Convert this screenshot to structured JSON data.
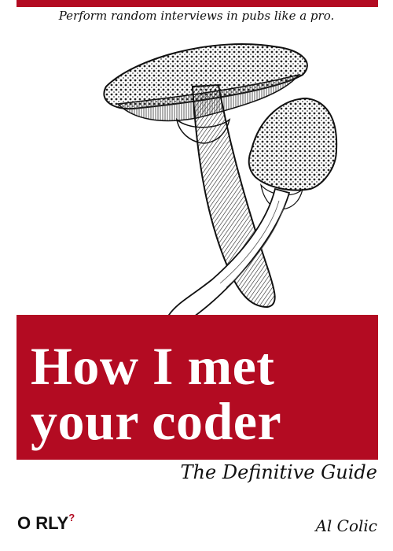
{
  "cover": {
    "tagline": "Perform random interviews in pubs like a pro.",
    "title": "How I met\nyour coder",
    "subtitle": "The Definitive Guide",
    "publisher": "O RLY",
    "publisher_mark": "?",
    "author": "Al Colic",
    "illustration": "mushrooms-engraving",
    "colors": {
      "accent": "#b30b22",
      "background": "#ffffff",
      "title_text": "#ffffff"
    }
  }
}
